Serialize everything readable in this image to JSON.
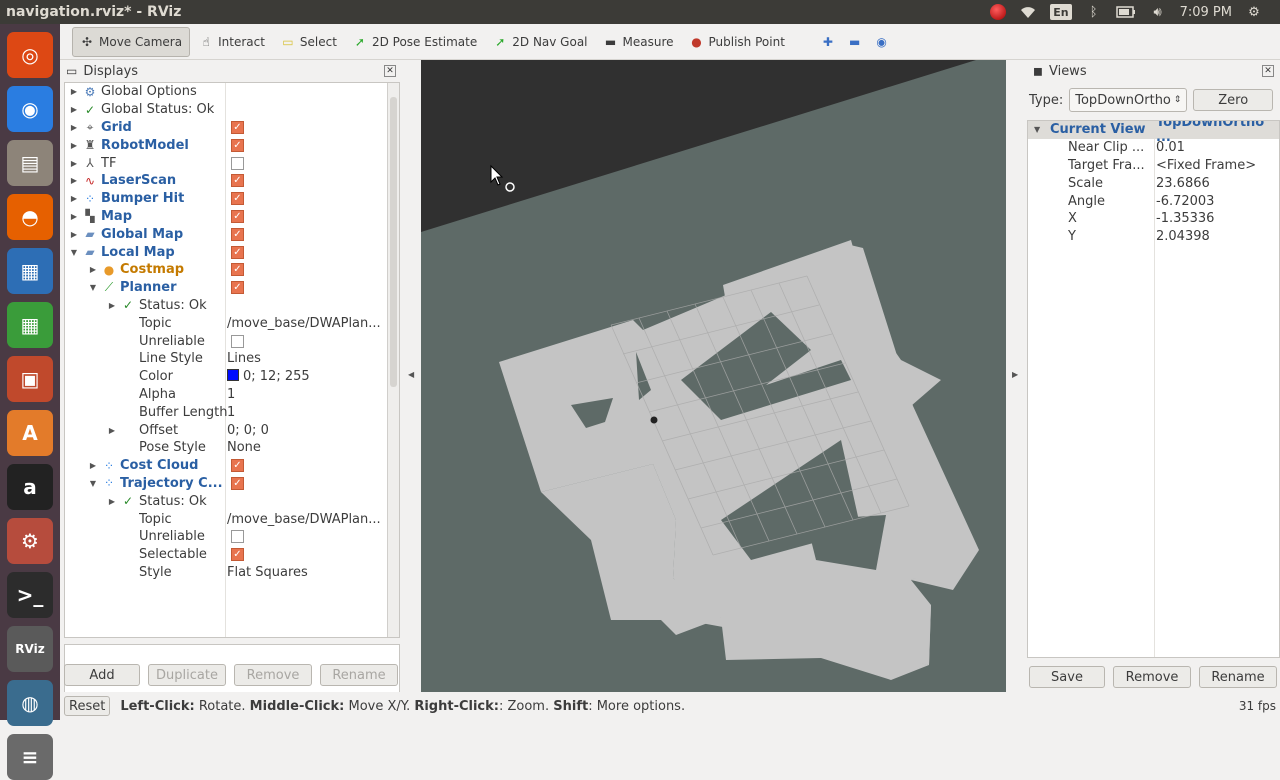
{
  "window": {
    "title": "navigation.rviz* - RViz"
  },
  "tray": {
    "language": "En",
    "time": "7:09 PM"
  },
  "launcher": {
    "items": [
      {
        "name": "ubuntu-icon",
        "glyph": "◎",
        "color": "#dd4814"
      },
      {
        "name": "chrome-icon",
        "glyph": "◉",
        "color": "#2a7de1"
      },
      {
        "name": "files-icon",
        "glyph": "▤",
        "color": "#8d8479"
      },
      {
        "name": "firefox-icon",
        "glyph": "◓",
        "color": "#e66000"
      },
      {
        "name": "writer-icon",
        "glyph": "▦",
        "color": "#2d6eb5"
      },
      {
        "name": "calc-icon",
        "glyph": "▦",
        "color": "#3a9c3a"
      },
      {
        "name": "impress-icon",
        "glyph": "▣",
        "color": "#c0492c"
      },
      {
        "name": "software-center-icon",
        "glyph": "A",
        "color": "#e37b2a"
      },
      {
        "name": "amazon-icon",
        "glyph": "a",
        "color": "#222222"
      },
      {
        "name": "settings-icon",
        "glyph": "⚙",
        "color": "#b64c3d"
      },
      {
        "name": "terminal-icon",
        "glyph": ">_",
        "color": "#2c2c2c"
      },
      {
        "name": "rviz-icon",
        "glyph": "RViz",
        "color": "#5a5a5a"
      },
      {
        "name": "gazebo-icon",
        "glyph": "◍",
        "color": "#3a6c8e"
      },
      {
        "name": "disk-icon",
        "glyph": "≡",
        "color": "#6a6a6a"
      }
    ]
  },
  "toolbar": {
    "tools": [
      {
        "name": "move-camera-tool",
        "icon": "camera-icon",
        "glyph": "✣",
        "label": "Move Camera",
        "active": true
      },
      {
        "name": "interact-tool",
        "icon": "hand-icon",
        "glyph": "☝",
        "label": "Interact"
      },
      {
        "name": "select-tool",
        "icon": "select-icon",
        "glyph": "▭",
        "label": "Select"
      },
      {
        "name": "pose-estimate-tool",
        "icon": "arrow-green-icon",
        "glyph": "➚",
        "label": "2D Pose Estimate"
      },
      {
        "name": "nav-goal-tool",
        "icon": "arrow-green-icon",
        "glyph": "➚",
        "label": "2D Nav Goal"
      },
      {
        "name": "measure-tool",
        "icon": "ruler-icon",
        "glyph": "▬",
        "label": "Measure"
      },
      {
        "name": "publish-point-tool",
        "icon": "pin-icon",
        "glyph": "●",
        "label": "Publish Point"
      }
    ],
    "extra": [
      {
        "name": "add-tool-icon",
        "glyph": "✚"
      },
      {
        "name": "remove-tool-icon",
        "glyph": "▬"
      },
      {
        "name": "tool-properties-icon",
        "glyph": "◉"
      }
    ]
  },
  "displays": {
    "title": "Displays",
    "rows": [
      {
        "depth": 0,
        "arrow": "▶",
        "icon": "gear-icon",
        "glyph": "⚙",
        "iconColor": "#4a7ab8",
        "label": "Global Options",
        "style": "",
        "val": "",
        "chk": null
      },
      {
        "depth": 0,
        "arrow": "▶",
        "icon": "check-icon",
        "glyph": "✓",
        "iconColor": "#2a8a2a",
        "label": "Global Status: Ok",
        "style": "",
        "val": "",
        "chk": null
      },
      {
        "depth": 0,
        "arrow": "▶",
        "icon": "grid-icon",
        "glyph": "⌖",
        "iconColor": "#555",
        "label": "Grid",
        "style": "blue",
        "val": "",
        "chk": true
      },
      {
        "depth": 0,
        "arrow": "▶",
        "icon": "robot-icon",
        "glyph": "♜",
        "iconColor": "#555",
        "label": "RobotModel",
        "style": "blue",
        "val": "",
        "chk": true
      },
      {
        "depth": 0,
        "arrow": "▶",
        "icon": "tf-icon",
        "glyph": "⅄",
        "iconColor": "#555",
        "label": "TF",
        "style": "",
        "val": "",
        "chk": false
      },
      {
        "depth": 0,
        "arrow": "▶",
        "icon": "laserscan-icon",
        "glyph": "∿",
        "iconColor": "#c62828",
        "label": "LaserScan",
        "style": "blue",
        "val": "",
        "chk": true
      },
      {
        "depth": 0,
        "arrow": "▶",
        "icon": "points-icon",
        "glyph": "⁘",
        "iconColor": "#2a7de1",
        "label": "Bumper Hit",
        "style": "blue",
        "val": "",
        "chk": true
      },
      {
        "depth": 0,
        "arrow": "▶",
        "icon": "map-icon",
        "glyph": "▚",
        "iconColor": "#555",
        "label": "Map",
        "style": "blue",
        "val": "",
        "chk": true
      },
      {
        "depth": 0,
        "arrow": "▶",
        "icon": "folder-icon",
        "glyph": "▰",
        "iconColor": "#6b8fbf",
        "label": "Global Map",
        "style": "blue",
        "val": "",
        "chk": true
      },
      {
        "depth": 0,
        "arrow": "▼",
        "icon": "folder-icon",
        "glyph": "▰",
        "iconColor": "#6b8fbf",
        "label": "Local Map",
        "style": "blue",
        "val": "",
        "chk": true
      },
      {
        "depth": 1,
        "arrow": "▶",
        "icon": "warning-icon",
        "glyph": "●",
        "iconColor": "#e89a2a",
        "label": "Costmap",
        "style": "orange",
        "val": "",
        "chk": true
      },
      {
        "depth": 1,
        "arrow": "▼",
        "icon": "path-icon",
        "glyph": "⟋",
        "iconColor": "#2a9a2a",
        "label": "Planner",
        "style": "blue",
        "val": "",
        "chk": true
      },
      {
        "depth": 2,
        "arrow": "▶",
        "icon": "check-icon",
        "glyph": "✓",
        "iconColor": "#2a8a2a",
        "label": "Status: Ok",
        "style": "",
        "val": "",
        "chk": null
      },
      {
        "depth": 2,
        "arrow": "",
        "icon": "",
        "glyph": "",
        "iconColor": "",
        "label": "Topic",
        "style": "",
        "val": "/move_base/DWAPlan...",
        "chk": null
      },
      {
        "depth": 2,
        "arrow": "",
        "icon": "",
        "glyph": "",
        "iconColor": "",
        "label": "Unreliable",
        "style": "",
        "val": "",
        "chk": false
      },
      {
        "depth": 2,
        "arrow": "",
        "icon": "",
        "glyph": "",
        "iconColor": "",
        "label": "Line Style",
        "style": "",
        "val": "Lines",
        "chk": null
      },
      {
        "depth": 2,
        "arrow": "",
        "icon": "",
        "glyph": "",
        "iconColor": "",
        "label": "Color",
        "style": "",
        "val": "0; 12; 255",
        "chk": null,
        "swatch": "#000cff"
      },
      {
        "depth": 2,
        "arrow": "",
        "icon": "",
        "glyph": "",
        "iconColor": "",
        "label": "Alpha",
        "style": "",
        "val": "1",
        "chk": null
      },
      {
        "depth": 2,
        "arrow": "",
        "icon": "",
        "glyph": "",
        "iconColor": "",
        "label": "Buffer Length",
        "style": "",
        "val": "1",
        "chk": null
      },
      {
        "depth": 2,
        "arrow": "▶",
        "icon": "",
        "glyph": "",
        "iconColor": "",
        "label": "Offset",
        "style": "",
        "val": "0; 0; 0",
        "chk": null
      },
      {
        "depth": 2,
        "arrow": "",
        "icon": "",
        "glyph": "",
        "iconColor": "",
        "label": "Pose Style",
        "style": "",
        "val": "None",
        "chk": null
      },
      {
        "depth": 1,
        "arrow": "▶",
        "icon": "points-icon",
        "glyph": "⁘",
        "iconColor": "#2a7de1",
        "label": "Cost Cloud",
        "style": "blue",
        "val": "",
        "chk": true
      },
      {
        "depth": 1,
        "arrow": "▼",
        "icon": "points-icon",
        "glyph": "⁘",
        "iconColor": "#2a7de1",
        "label": "Trajectory C...",
        "style": "blue",
        "val": "",
        "chk": true
      },
      {
        "depth": 2,
        "arrow": "▶",
        "icon": "check-icon",
        "glyph": "✓",
        "iconColor": "#2a8a2a",
        "label": "Status: Ok",
        "style": "",
        "val": "",
        "chk": null
      },
      {
        "depth": 2,
        "arrow": "",
        "icon": "",
        "glyph": "",
        "iconColor": "",
        "label": "Topic",
        "style": "",
        "val": "/move_base/DWAPlan...",
        "chk": null
      },
      {
        "depth": 2,
        "arrow": "",
        "icon": "",
        "glyph": "",
        "iconColor": "",
        "label": "Unreliable",
        "style": "",
        "val": "",
        "chk": false
      },
      {
        "depth": 2,
        "arrow": "",
        "icon": "",
        "glyph": "",
        "iconColor": "",
        "label": "Selectable",
        "style": "",
        "val": "",
        "chk": true
      },
      {
        "depth": 2,
        "arrow": "",
        "icon": "",
        "glyph": "",
        "iconColor": "",
        "label": "Style",
        "style": "",
        "val": "Flat Squares",
        "chk": null
      }
    ],
    "buttons": {
      "add": "Add",
      "duplicate": "Duplicate",
      "remove": "Remove",
      "rename": "Rename"
    }
  },
  "views": {
    "title": "Views",
    "type_label": "Type:",
    "type_value": "TopDownOrtho",
    "zero_label": "Zero",
    "current_view": {
      "label": "Current View",
      "value": "TopDownOrtho ..."
    },
    "props": [
      {
        "k": "Near Clip ...",
        "v": "0.01"
      },
      {
        "k": "Target Fra...",
        "v": "<Fixed Frame>"
      },
      {
        "k": "Scale",
        "v": "23.6866"
      },
      {
        "k": "Angle",
        "v": "-6.72003"
      },
      {
        "k": "X",
        "v": "-1.35336"
      },
      {
        "k": "Y",
        "v": "2.04398"
      }
    ],
    "buttons": {
      "save": "Save",
      "remove": "Remove",
      "rename": "Rename"
    }
  },
  "statusbar": {
    "reset": "Reset",
    "hint_parts": [
      {
        "b": "Left-Click:",
        "t": " Rotate. "
      },
      {
        "b": "Middle-Click:",
        "t": " Move X/Y. "
      },
      {
        "b": "Right-Click:",
        "t": ": Zoom. "
      },
      {
        "b": "Shift",
        "t": ": More options."
      }
    ],
    "fps": "31 fps"
  },
  "colors": {
    "map_background": "#5e6a67",
    "free_space": "#c4c4c4",
    "viewport_bg": "#303030",
    "checkbox_on": "#e8744f",
    "link_blue": "#2a5fa3"
  }
}
